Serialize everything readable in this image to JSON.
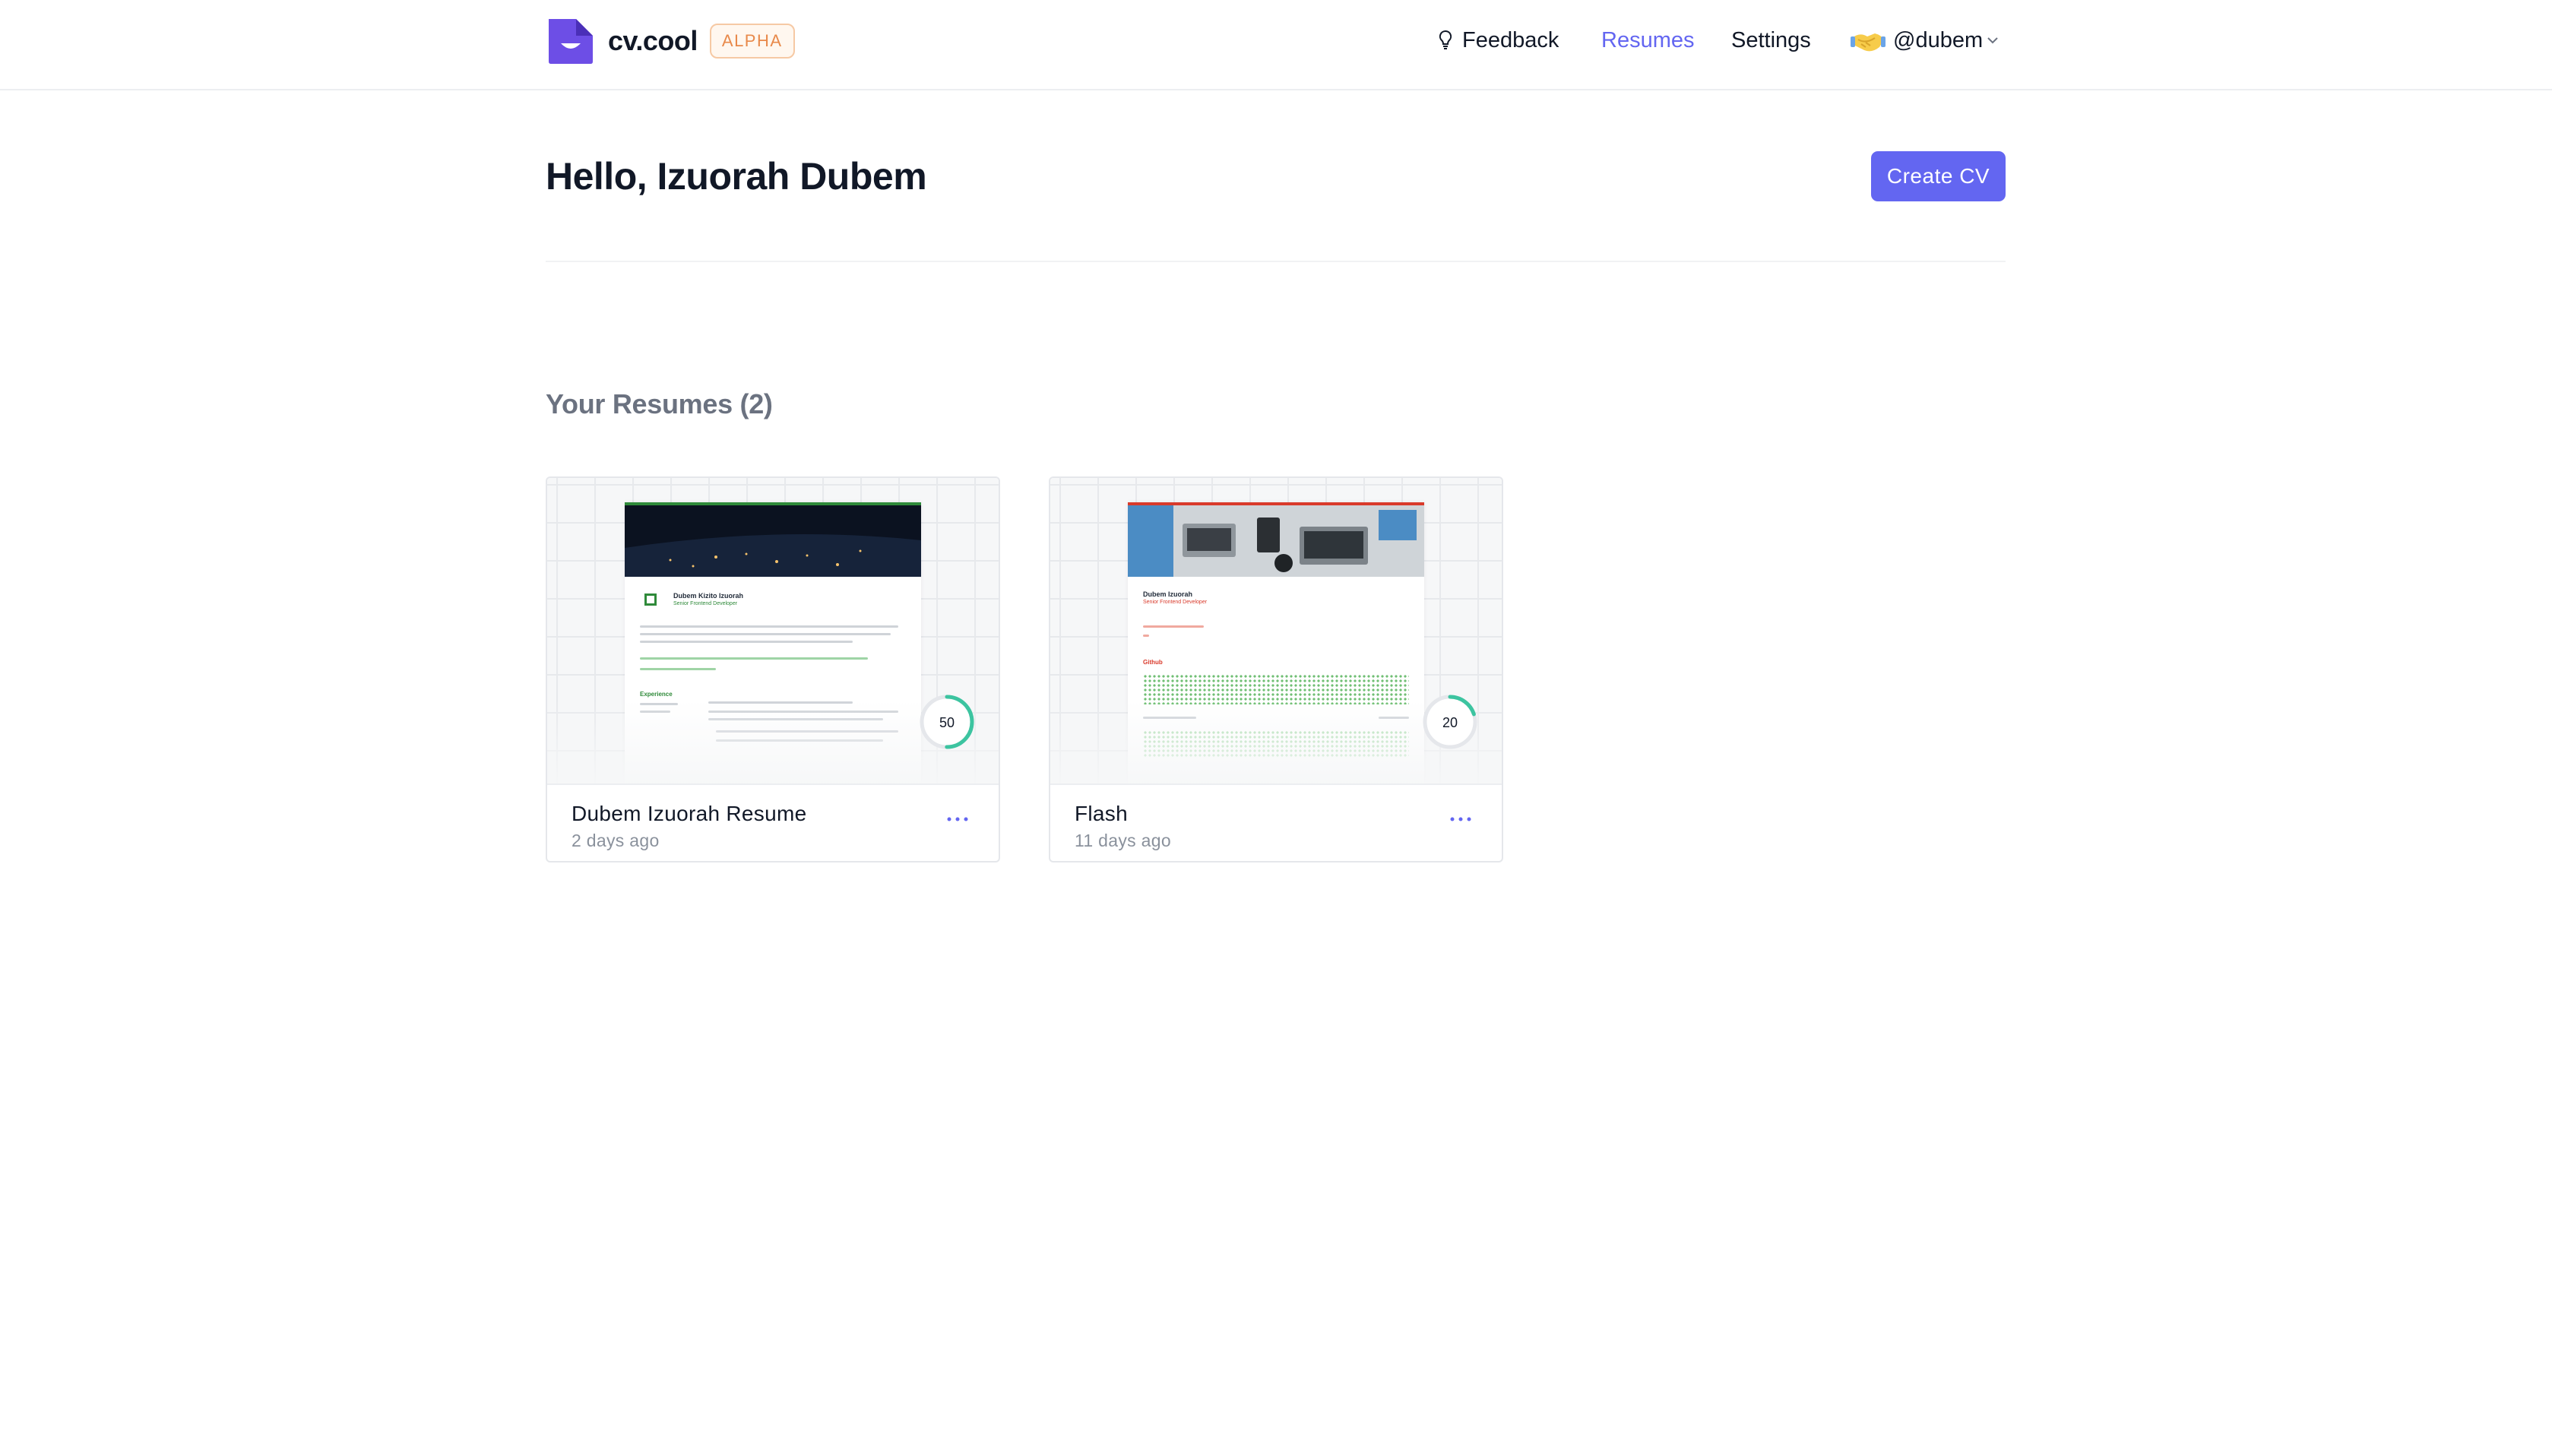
{
  "header": {
    "brand_name": "cv.cool",
    "badge": "ALPHA",
    "nav": {
      "feedback": "Feedback",
      "resumes": "Resumes",
      "settings": "Settings",
      "user": "@dubem"
    }
  },
  "main": {
    "greeting": "Hello, Izuorah Dubem",
    "create_button": "Create CV",
    "section_title": "Your Resumes (2)"
  },
  "resumes": [
    {
      "title": "Dubem Izuorah Resume",
      "updated": "2 days ago",
      "score": "50",
      "score_fraction": 0.5,
      "accent": "#2f8a3a",
      "preview_name": "Dubem Kizito Izuorah",
      "preview_role": "Senior Frontend Developer",
      "preview_section": "Experience"
    },
    {
      "title": "Flash",
      "updated": "11 days ago",
      "score": "20",
      "score_fraction": 0.2,
      "accent": "#d93a2b",
      "preview_name": "Dubem Izuorah",
      "preview_role": "Senior Frontend Developer",
      "preview_section": "Github"
    }
  ],
  "colors": {
    "accent": "#6366f1",
    "score_ring": "#3cc4a0",
    "badge_text": "#e8894a"
  }
}
